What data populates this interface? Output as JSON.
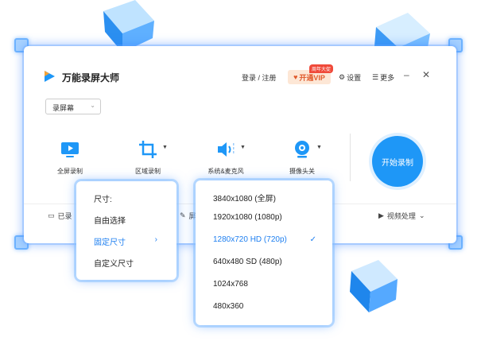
{
  "app": {
    "title": "万能录屏大师"
  },
  "header": {
    "login": "登录 / 注册",
    "vip": "开通VIP",
    "vip_tag": "周年大促",
    "settings": "设置",
    "more": "更多"
  },
  "mode_select": {
    "value": "录屏幕"
  },
  "tools": {
    "fullscreen": "全屏录制",
    "region": "区域录制",
    "audio": "系统&麦克风",
    "camera": "摄像头关"
  },
  "start_button": "开始录制",
  "bottom": {
    "recorded": "已录",
    "screenshot": "屏",
    "video_process": "视频处理"
  },
  "size_menu": {
    "header": "尺寸:",
    "items": [
      "自由选择",
      "固定尺寸",
      "自定义尺寸"
    ],
    "selected_index": 1
  },
  "resolution_menu": {
    "items": [
      "3840x1080 (全屏)",
      "1920x1080 (1080p)",
      "1280x720 HD (720p)",
      "640x480 SD (480p)",
      "1024x768",
      "480x360"
    ],
    "selected_index": 2
  },
  "colors": {
    "accent": "#1e97f7",
    "vip": "#e0592a",
    "glow": "#6fb4ff"
  }
}
